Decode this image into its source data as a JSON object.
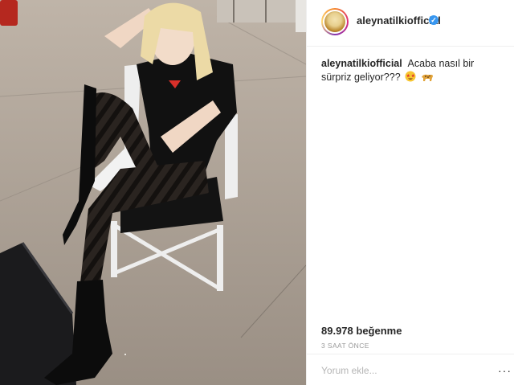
{
  "post": {
    "username": "aleynatilkiofficial",
    "verified_glyph": "✓",
    "caption_user": "aleynatilkiofficial",
    "caption_text": "Acaba nasıl bir sürpriz geliyor???",
    "caption_emojis": [
      "star-struck-emoji",
      "leopard-emoji"
    ],
    "likes": "89.978 beğenme",
    "time": "3 SAAT ÖNCE"
  },
  "comment": {
    "placeholder": "Yorum ekle...",
    "more_label": "···"
  },
  "colors": {
    "verified_blue": "#3897f0",
    "text_dark": "#262626",
    "text_muted": "#999999"
  },
  "icons": [
    "verified-badge-icon",
    "more-options-icon"
  ]
}
